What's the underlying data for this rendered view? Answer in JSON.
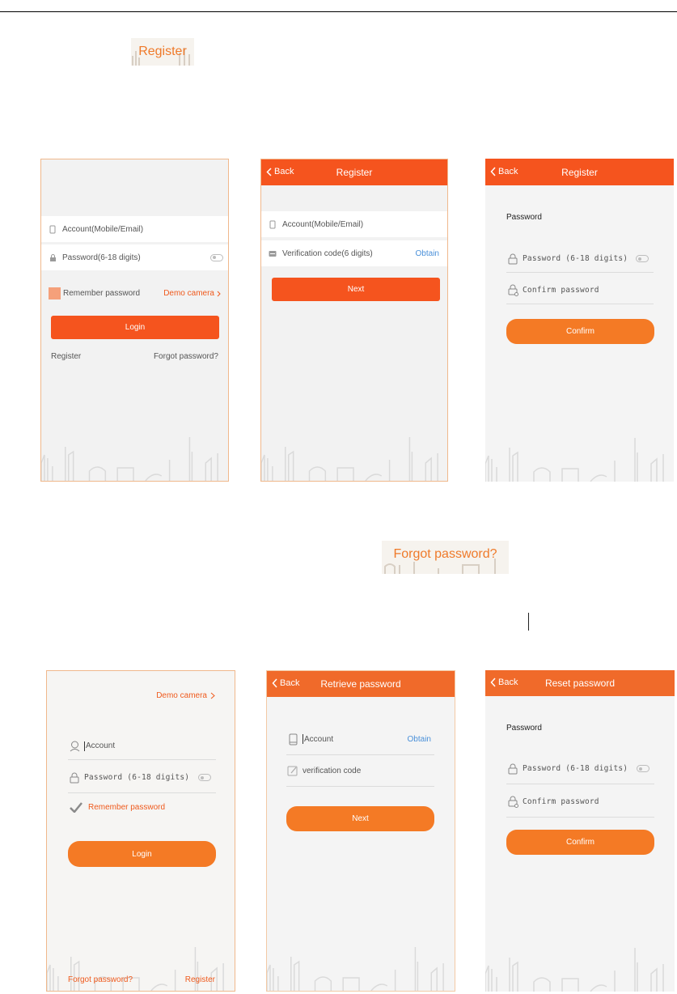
{
  "callouts": {
    "register": "Register",
    "forgot": "Forgot password?"
  },
  "screens": {
    "login_v1": {
      "account_placeholder": "Account(Mobile/Email)",
      "password_placeholder": "Password(6-18 digits)",
      "remember": "Remember password",
      "demo": "Demo camera",
      "login": "Login",
      "register": "Register",
      "forgot": "Forgot password?"
    },
    "register_v1": {
      "back": "Back",
      "title": "Register",
      "account_placeholder": "Account(Mobile/Email)",
      "verification_placeholder": "Verification code(6 digits)",
      "obtain": "Obtain",
      "next": "Next"
    },
    "register_pw": {
      "back": "Back",
      "title": "Register",
      "section": "Password",
      "password_placeholder": "Password (6-18 digits)",
      "confirm_placeholder": "Confirm password",
      "confirm": "Confirm"
    },
    "login_v2": {
      "demo": "Demo camera",
      "account_placeholder": "Account",
      "password_placeholder": "Password (6-18 digits)",
      "remember": "Remember password",
      "login": "Login",
      "forgot": "Forgot password?",
      "register": "Register"
    },
    "retrieve": {
      "back": "Back",
      "title": "Retrieve password",
      "account_placeholder": "Account",
      "obtain": "Obtain",
      "verification_placeholder": "verification code",
      "next": "Next"
    },
    "reset": {
      "back": "Back",
      "title": "Reset password",
      "section": "Password",
      "password_placeholder": "Password (6-18 digits)",
      "confirm_placeholder": "Confirm password",
      "confirm": "Confirm"
    }
  },
  "colors": {
    "brand_orange": "#f5541e",
    "pill_orange": "#f47a25",
    "link_blue": "#4a90d9",
    "frame_border": "#f0b88c"
  },
  "icons": [
    "phone-icon",
    "lock-icon",
    "message-icon",
    "user-icon",
    "pencil-icon",
    "chevron-left-icon",
    "chevron-right-icon",
    "check-icon",
    "eye-toggle-icon",
    "skyline-illustration"
  ]
}
